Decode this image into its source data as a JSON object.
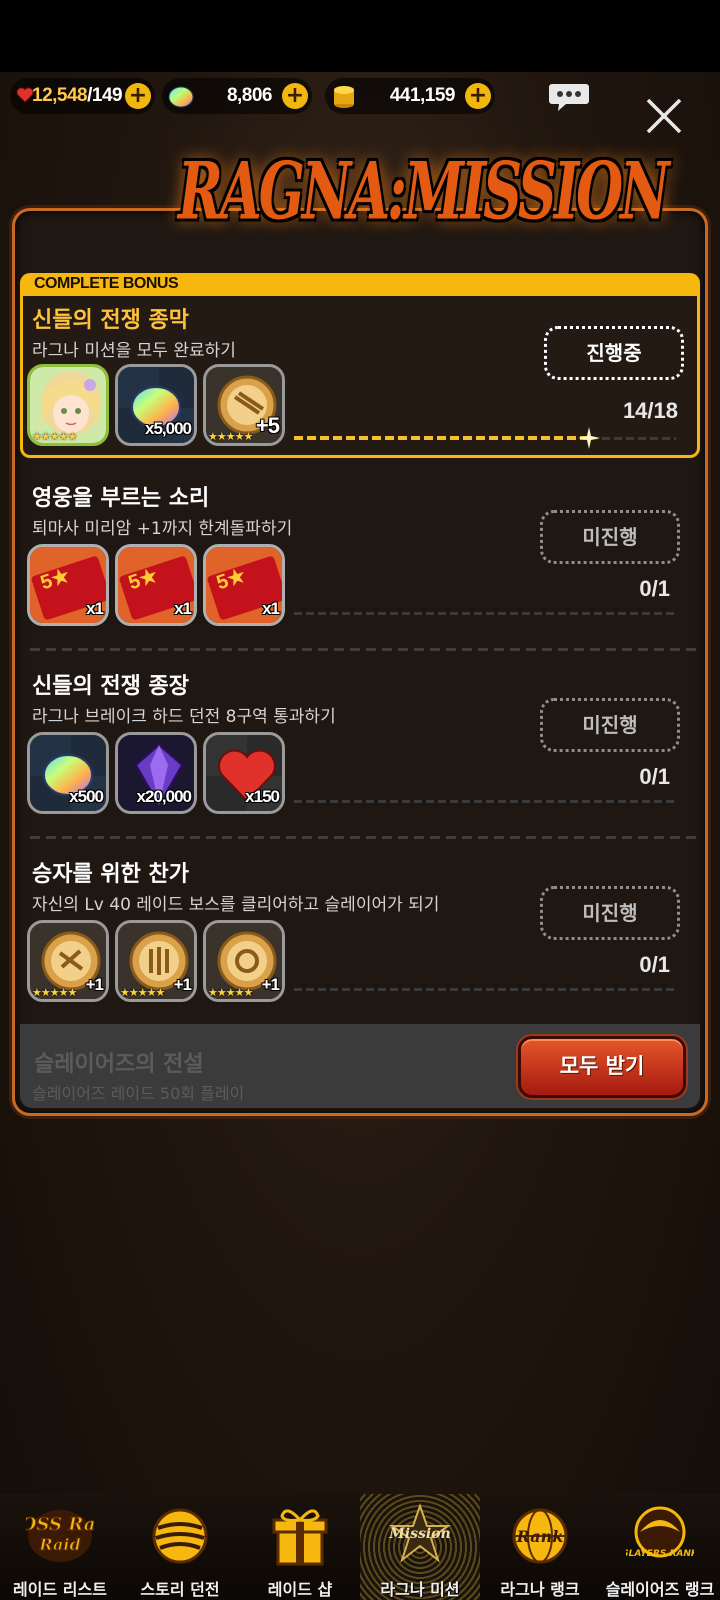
{
  "resources": {
    "stamina_current": "12,548",
    "stamina_max": "/149",
    "gems": "8,806",
    "gold": "441,159"
  },
  "icons": {
    "stamina": "heart-icon",
    "gems": "gem-icon",
    "gold": "coin-icon",
    "chat": "chat-bubble-icon",
    "close": "close-icon",
    "add": "plus-icon"
  },
  "title": "RAGNA:MISSION",
  "complete_bonus": {
    "tab_label": "COMPLETE BONUS",
    "title": "신들의 전쟁 종막",
    "description": "라그나 미션을 모두 완료하기",
    "status": "진행중",
    "progress": "14/18",
    "progress_fraction": 0.78,
    "rewards": [
      {
        "icon": "character-portrait-icon",
        "qty": "",
        "stars": "★★★★★"
      },
      {
        "icon": "rainbow-gem-icon",
        "qty": "x5,000",
        "stars": ""
      },
      {
        "icon": "gold-medal-icon",
        "qty": "+5",
        "stars": "★★★★★"
      }
    ]
  },
  "missions": [
    {
      "title": "영웅을 부르는 소리",
      "description": "퇴마사 미리암 +1까지 한계돌파하기",
      "status": "미진행",
      "progress": "0/1",
      "rewards": [
        {
          "icon": "5-star-ticket-icon",
          "qty": "x1",
          "stars": ""
        },
        {
          "icon": "5-star-ticket-icon",
          "qty": "x1",
          "stars": ""
        },
        {
          "icon": "5-star-ticket-icon",
          "qty": "x1",
          "stars": ""
        }
      ]
    },
    {
      "title": "신들의 전쟁 종장",
      "description": "라그나 브레이크 하드 던전 8구역 통과하기",
      "status": "미진행",
      "progress": "0/1",
      "rewards": [
        {
          "icon": "rainbow-gem-icon",
          "qty": "x500",
          "stars": ""
        },
        {
          "icon": "purple-gem-icon",
          "qty": "x20,000",
          "stars": ""
        },
        {
          "icon": "heart-icon",
          "qty": "x150",
          "stars": ""
        }
      ]
    },
    {
      "title": "승자를 위한 찬가",
      "description": "자신의 Lv 40 레이드 보스를 클리어하고 슬레이어가 되기",
      "status": "미진행",
      "progress": "0/1",
      "rewards": [
        {
          "icon": "gold-medal-icon",
          "qty": "+1",
          "stars": "★★★★★"
        },
        {
          "icon": "gold-medal-icon",
          "qty": "+1",
          "stars": "★★★★★"
        },
        {
          "icon": "gold-medal-icon",
          "qty": "+1",
          "stars": "★★★★★"
        }
      ]
    }
  ],
  "faded_mission": {
    "title": "슬레이어즈의 전설",
    "description": "슬레이어즈 레이드 50회 플레이"
  },
  "claim_all_label": "모두 받기",
  "nav": [
    {
      "label": "레이드 리스트",
      "icon": "boss-raid-icon",
      "logo_text": "BOSS Raid"
    },
    {
      "label": "스토리 던전",
      "icon": "story-dungeon-icon",
      "logo_text": ""
    },
    {
      "label": "레이드 샵",
      "icon": "gift-icon",
      "logo_text": ""
    },
    {
      "label": "라그나 미션",
      "icon": "mission-icon",
      "logo_text": "Mission"
    },
    {
      "label": "라그나 랭크",
      "icon": "rank-globe-icon",
      "logo_text": "Rank"
    },
    {
      "label": "슬레이어즈 랭크",
      "icon": "slayers-rank-icon",
      "logo_text": "SLAYERS RANK"
    }
  ],
  "active_nav": "라그나 미션"
}
